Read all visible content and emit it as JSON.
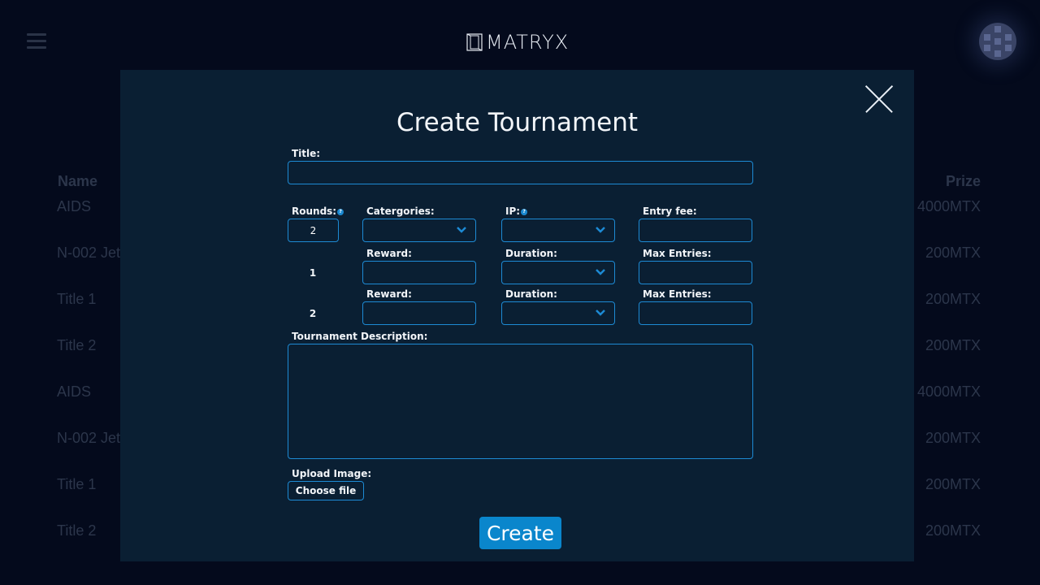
{
  "app": {
    "logo_text": "MATRYX"
  },
  "background_table": {
    "headers": {
      "name": "Name",
      "prize": "Prize"
    },
    "rows": [
      {
        "name": "AIDS",
        "prize": "4000MTX"
      },
      {
        "name": "N-002 Jet",
        "prize": "200MTX"
      },
      {
        "name": "Title 1",
        "prize": "200MTX"
      },
      {
        "name": "Title 2",
        "prize": "200MTX"
      },
      {
        "name": "AIDS",
        "prize": "4000MTX"
      },
      {
        "name": "N-002 Jet",
        "prize": "200MTX"
      },
      {
        "name": "Title 1",
        "prize": "200MTX"
      },
      {
        "name": "Title 2",
        "prize": "200MTX"
      }
    ]
  },
  "modal": {
    "title": "Create Tournament",
    "title_label": "Title:",
    "title_value": "",
    "rounds_label": "Rounds:",
    "rounds_value": "2",
    "categories_label": "Catergories:",
    "ip_label": "IP:",
    "entry_fee_label": "Entry fee:",
    "rounds": [
      {
        "number": "1",
        "reward_label": "Reward:",
        "duration_label": "Duration:",
        "max_entries_label": "Max Entries:"
      },
      {
        "number": "2",
        "reward_label": "Reward:",
        "duration_label": "Duration:",
        "max_entries_label": "Max Entries:"
      }
    ],
    "description_label": "Tournament Description:",
    "upload_label": "Upload Image:",
    "choose_file_label": "Choose file",
    "create_label": "Create",
    "help_glyph": "?"
  },
  "colors": {
    "accent": "#1d8ad4",
    "create_button": "#0a86cc",
    "modal_background": "#0a1f33",
    "page_background": "#040a1c"
  }
}
